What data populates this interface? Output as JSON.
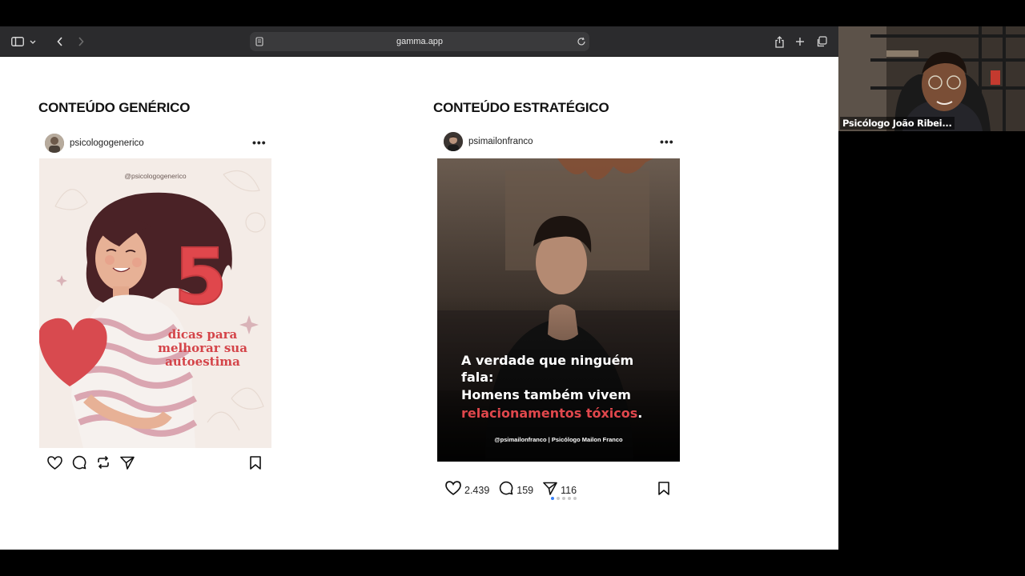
{
  "browser": {
    "url": "gamma.app"
  },
  "left": {
    "title": "CONTEÚDO GENÉRICO",
    "handle": "psicologogenerico",
    "image_handle": "@psicologogenerico",
    "big_number": "5",
    "headline_line1": "dicas para",
    "headline_line2": "melhorar sua",
    "headline_line3": "autoestima"
  },
  "right": {
    "title": "CONTEÚDO ESTRATÉGICO",
    "handle": "psimailonfranco",
    "caption_line1": "A verdade que ninguém fala:",
    "caption_line2": "Homens também vivem",
    "caption_line3": "relacionamentos tóxicos",
    "caption_period": ".",
    "credit": "@psimailonfranco | Psicólogo Mailon Franco",
    "likes": "2.439",
    "comments": "159",
    "shares": "116",
    "carousel_total": 5,
    "carousel_active": 1
  },
  "webcam": {
    "name": "Psicólogo João Ribei..."
  },
  "colors": {
    "accent_red": "#e0474c",
    "progress_active": "#a9c7ec",
    "progress_done": "#6f97d6",
    "toolbar_bg": "#2b2b2d"
  },
  "progress": {
    "segments_total": 6,
    "segments_done": 6
  }
}
